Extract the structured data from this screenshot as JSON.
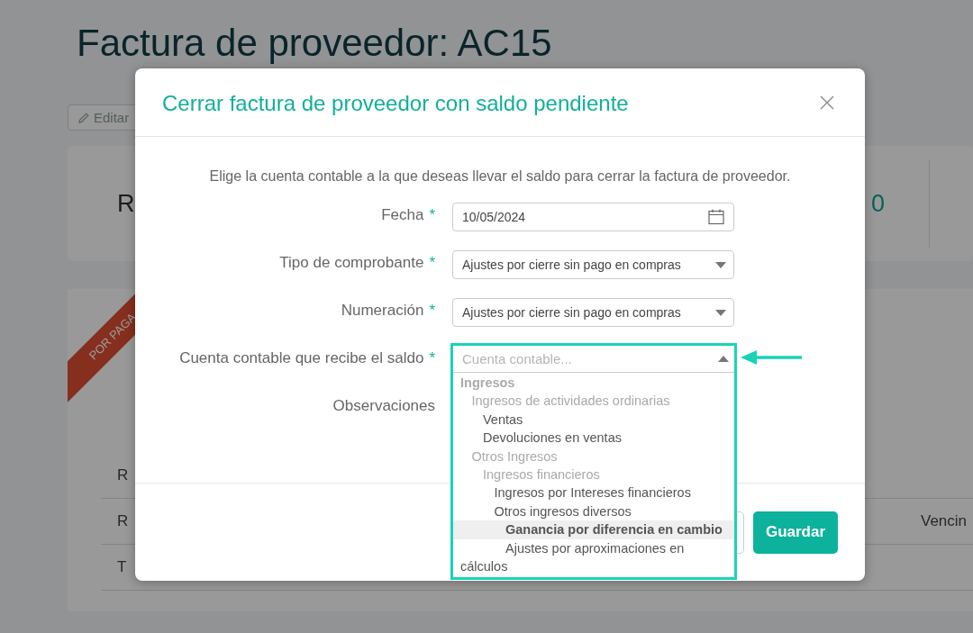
{
  "page": {
    "title": "Factura de proveedor: AC15",
    "edit_button": "Editar",
    "summary": {
      "column_1": "R",
      "column_2": "0"
    },
    "status_ribbon": "POR PAGA",
    "rows": [
      {
        "column_1": "R"
      },
      {
        "column_1": "R",
        "column_2": "Vencin"
      },
      {
        "column_1": "T"
      }
    ]
  },
  "dialog": {
    "title": "Cerrar factura de proveedor con saldo pendiente",
    "intro": "Elige la cuenta contable a la que deseas llevar el saldo para cerrar la factura de proveedor.",
    "fields": [
      {
        "kind": "date",
        "label": "Fecha",
        "required_mark": "*",
        "value": "10/05/2024"
      },
      {
        "kind": "select",
        "label": "Tipo de comprobante",
        "required_mark": "*",
        "value": "Ajustes por cierre sin pago en compras"
      },
      {
        "kind": "select",
        "label": "Numeración",
        "required_mark": "*",
        "value": "Ajustes por cierre sin pago en compras"
      },
      {
        "kind": "combobox",
        "label": "Cuenta contable que recibe el saldo",
        "required_mark": "*",
        "placeholder": "Cuenta contable...",
        "expanded": true,
        "highlighted": true
      },
      {
        "kind": "textarea",
        "label": "Observaciones"
      }
    ],
    "options": [
      {
        "label": "Ingresos",
        "disabled": true,
        "selected": false,
        "children": [
          {
            "label": "Ingresos de actividades ordinarias",
            "disabled": true,
            "selected": false,
            "children": [
              {
                "label": "Ventas",
                "disabled": false,
                "selected": false
              },
              {
                "label": "Devoluciones en ventas",
                "disabled": false,
                "selected": false
              }
            ]
          },
          {
            "label": "Otros Ingresos",
            "disabled": true,
            "selected": false,
            "children": [
              {
                "label": "Ingresos financieros",
                "disabled": true,
                "selected": false,
                "children": [
                  {
                    "label": "Ingresos por Intereses financieros",
                    "disabled": false,
                    "selected": false
                  },
                  {
                    "label": "Otros ingresos diversos",
                    "disabled": false,
                    "selected": false,
                    "children": [
                      {
                        "label": "Ganancia por diferencia en cambio",
                        "disabled": false,
                        "selected": true
                      },
                      {
                        "label": "Ajustes por aproximaciones en cálculos",
                        "disabled": false,
                        "selected": false
                      }
                    ]
                  }
                ]
              }
            ]
          }
        ]
      }
    ],
    "buttons": [
      {
        "kind": "secondary"
      },
      {
        "kind": "primary",
        "label": "Guardar"
      }
    ]
  }
}
